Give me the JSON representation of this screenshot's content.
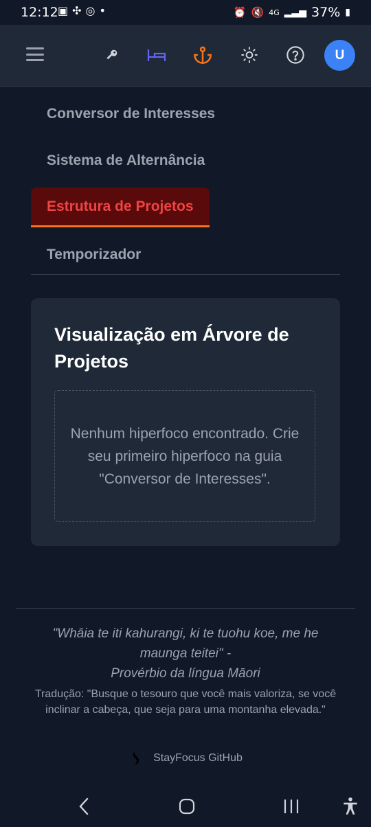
{
  "status_bar": {
    "time": "12:12",
    "network": "4G",
    "battery": "37%"
  },
  "header": {
    "menu_icon": "hamburger-menu-icon",
    "icons": [
      "key-icon",
      "bed-icon",
      "anchor-icon",
      "sun-icon",
      "help-icon"
    ],
    "avatar_initial": "U",
    "colors": {
      "bed": "#6366f1",
      "anchor": "#f97316",
      "avatar": "#3b82f6"
    }
  },
  "tabs": [
    {
      "label": "Conversor de Interesses",
      "active": false
    },
    {
      "label": "Sistema de Alternância",
      "active": false
    },
    {
      "label": "Estrutura de Projetos",
      "active": true
    },
    {
      "label": "Temporizador",
      "active": false
    }
  ],
  "card": {
    "title": "Visualização em Árvore de Projetos",
    "empty_message": "Nenhum hiperfoco encontrado. Crie seu primeiro hiperfoco na guia \"Conversor de Interesses\"."
  },
  "footer": {
    "quote": "\"Whāia te iti kahurangi, ki te tuohu koe, me he maunga teitei\" -",
    "quote_source": "Provérbio da língua Māori",
    "translation": "Tradução: \"Busque o tesouro que você mais valoriza, se você inclinar a cabeça, que seja para uma montanha elevada.\"",
    "github_label": "StayFocus GitHub"
  }
}
